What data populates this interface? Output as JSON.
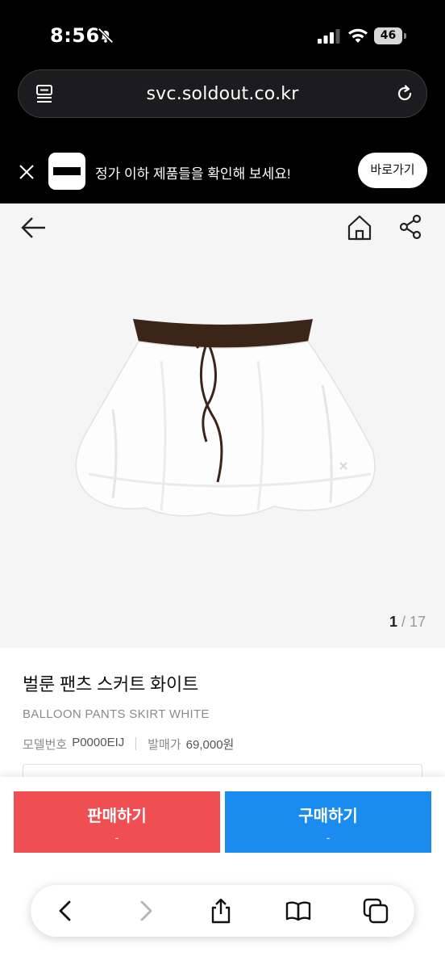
{
  "status_bar": {
    "time": "8:56",
    "battery": "46"
  },
  "url_bar": {
    "url": "svc.soldout.co.kr"
  },
  "banner": {
    "text": "정가 이하 제품들을 확인해 보세요!",
    "button_label": "바로가기"
  },
  "product": {
    "image_index": "1",
    "image_total": "/ 17",
    "name_ko": "벌룬 팬츠 스커트 화이트",
    "name_en": "BALLOON PANTS SKIRT WHITE",
    "model_label": "모델번호",
    "model_value": "P0000EIJ",
    "release_price_label": "발매가",
    "release_price_value": "69,000원"
  },
  "actions": {
    "sell_label": "판매하기",
    "sell_price": "-",
    "buy_label": "구매하기",
    "buy_price": "-",
    "sell_color": "#ef4f52",
    "buy_color": "#1a8cf0"
  },
  "icons": [
    "bell-slash-icon",
    "signal-icon",
    "wifi-icon",
    "reader-icon",
    "reload-icon",
    "close-icon",
    "back-arrow-icon",
    "home-icon",
    "share-icon",
    "chevron-left-icon",
    "chevron-right-icon",
    "share-up-icon",
    "book-icon",
    "tabs-icon"
  ]
}
